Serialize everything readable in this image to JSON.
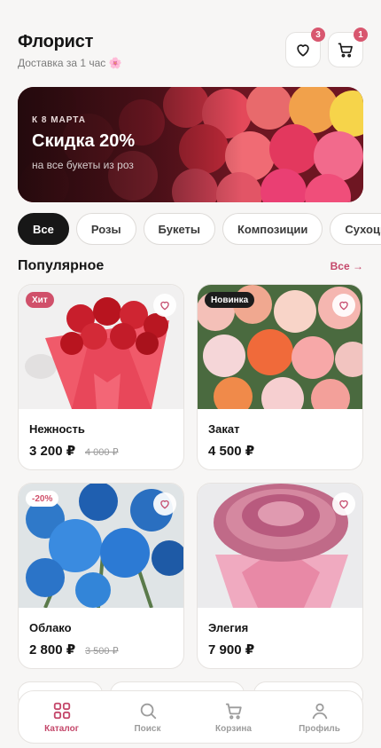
{
  "header": {
    "title": "Флорист",
    "subtitle": "Доставка за 1 час",
    "subtitle_emoji": "🌸",
    "favorites_count": "3",
    "cart_count": "1"
  },
  "banner": {
    "kicker": "К 8 МАРТА",
    "headline": "Скидка 20%",
    "subtext": "на все букеты из роз"
  },
  "categories": [
    "Все",
    "Розы",
    "Букеты",
    "Композиции",
    "Сухоцветы"
  ],
  "popular": {
    "title": "Популярное",
    "all_label": "Все →"
  },
  "products": [
    {
      "name": "Нежность",
      "price": "3 200 ₽",
      "old_price": "4 000 ₽",
      "tag": "Хит"
    },
    {
      "name": "Закат",
      "price": "4 500 ₽",
      "old_price": "",
      "tag": "Новинка"
    },
    {
      "name": "Облако",
      "price": "2 800 ₽",
      "old_price": "3 500 ₽",
      "tag": "-20%"
    },
    {
      "name": "Элегия",
      "price": "7 900 ₽",
      "old_price": "",
      "tag": ""
    }
  ],
  "tabbar": [
    {
      "label": "Каталог",
      "icon": "grid-icon"
    },
    {
      "label": "Поиск",
      "icon": "search-icon"
    },
    {
      "label": "Корзина",
      "icon": "cart-icon"
    },
    {
      "label": "Профиль",
      "icon": "user-icon"
    }
  ],
  "colors": {
    "accent": "#c4476a",
    "badge": "#d8576f",
    "dark": "#171717"
  }
}
